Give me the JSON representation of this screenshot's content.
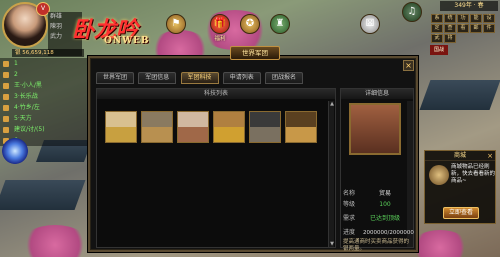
{
  "player": {
    "vip": "V",
    "info_lines": [
      "群雄",
      "陳羽",
      "武力"
    ],
    "money": "银 56,659,118"
  },
  "logo": {
    "title": "卧龙吟",
    "subtitle": "ONWEB"
  },
  "stats": [
    "1",
    "2",
    "王·小人/黑",
    "3·长乐战",
    "4·竹乡/左",
    "5·天方",
    "建议/讨/(5)",
    "6"
  ],
  "top_icons": [
    {
      "label": "",
      "icon": "clan-flag-icon",
      "glyph": "⚑"
    },
    {
      "label": "福利",
      "icon": "gift-icon",
      "glyph": "🎁"
    },
    {
      "label": "",
      "icon": "medal-icon",
      "glyph": "✪"
    },
    {
      "label": "",
      "icon": "castle-icon",
      "glyph": "♜"
    },
    {
      "label": "",
      "icon": "dice-icon",
      "glyph": "⚄"
    },
    {
      "label": "",
      "icon": "music-icon",
      "glyph": "♫"
    }
  ],
  "day_label": "349年 · 春",
  "right_buttons": [
    "系",
    "统",
    "功",
    "能",
    "设",
    "定",
    "查",
    "看",
    "邮",
    "件",
    "武",
    "将"
  ],
  "right_label": "国战",
  "window": {
    "title": "世界军团",
    "close": "×",
    "tabs": [
      "世界军团",
      "军团信息",
      "军团科技",
      "申请列表",
      "团战报名"
    ],
    "active_tab": 2,
    "list_header": "科技列表",
    "items": [
      {
        "name": "tech-1",
        "color": "#c8a040"
      },
      {
        "name": "tech-2",
        "color": "#b89050"
      },
      {
        "name": "tech-3",
        "color": "#a06848"
      },
      {
        "name": "tech-4",
        "color": "#d0a030"
      },
      {
        "name": "tech-5",
        "color": "#7a7060"
      },
      {
        "name": "tech-6",
        "color": "#c89848"
      }
    ],
    "detail": {
      "header": "详细信息",
      "name_label": "名称",
      "name_value": "贸易",
      "level_label": "等级",
      "level_value": "100",
      "need_label": "需求",
      "need_value": "已达到顶级",
      "progress_label": "进度",
      "progress_value": "2000000/2000000",
      "description": "提高通商时买卖商品获得的银两量。"
    }
  },
  "popup": {
    "title": "商城",
    "desc": "商城物品已经刷新，快去看看新的商品~",
    "button": "立即查看",
    "close": "×"
  }
}
